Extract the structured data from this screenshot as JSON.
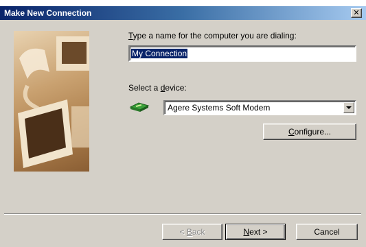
{
  "window": {
    "title": "Make New Connection",
    "close_glyph": "✕"
  },
  "form": {
    "name_label_accel": "T",
    "name_label_rest": "ype a name for the computer you are dialing:",
    "name_value": "My Connection",
    "device_label_pre": "Select a ",
    "device_label_accel": "d",
    "device_label_rest": "evice:",
    "device_value": "Agere Systems Soft Modem",
    "device_icon": "modem-icon",
    "configure_accel": "C",
    "configure_rest": "onfigure..."
  },
  "buttons": {
    "back_pre": "< ",
    "back_accel": "B",
    "back_rest": "ack",
    "next_accel": "N",
    "next_rest": "ext >",
    "cancel": "Cancel"
  },
  "colors": {
    "title_gradient_start": "#0a246a",
    "title_gradient_end": "#a6caf0",
    "dialog_face": "#d4d0c8",
    "selection": "#0a246a"
  }
}
